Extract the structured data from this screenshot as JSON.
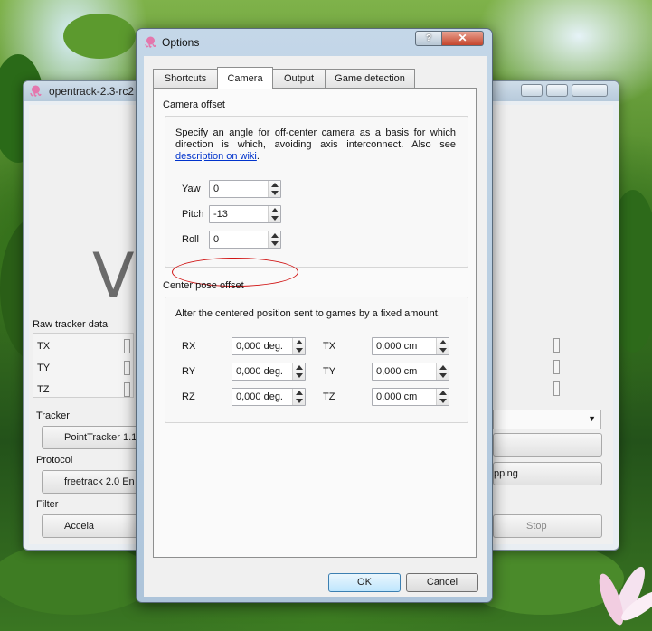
{
  "main_window": {
    "title": "opentrack-2.3-rc2",
    "big_text": "VI",
    "raw_tracker_label": "Raw tracker data",
    "axes": [
      "TX",
      "TY",
      "TZ"
    ],
    "tracker_label": "Tracker",
    "tracker_value": "PointTracker 1.1",
    "protocol_label": "Protocol",
    "protocol_value": "freetrack 2.0 En",
    "filter_label": "Filter",
    "filter_value": "Accela",
    "mapping_button": "pping",
    "stop_button": "Stop"
  },
  "dialog": {
    "title": "Options",
    "help_glyph": "?",
    "close_glyph": "✕",
    "tabs": [
      {
        "label": "Shortcuts"
      },
      {
        "label": "Camera"
      },
      {
        "label": "Output"
      },
      {
        "label": "Game detection"
      }
    ],
    "camera_offset": {
      "title": "Camera offset",
      "description": "Specify an angle for off-center camera as a basis for which direction is which, avoiding axis interconnect. Also see",
      "link_text": "description on wiki",
      "link_suffix": ".",
      "fields": [
        {
          "label": "Yaw",
          "value": "0"
        },
        {
          "label": "Pitch",
          "value": "-13"
        },
        {
          "label": "Roll",
          "value": "0"
        }
      ]
    },
    "center_pose": {
      "title": "Center pose offset",
      "description": "Alter the centered position sent to games by a fixed amount.",
      "rows": [
        {
          "rot_label": "RX",
          "rot_value": "0,000 deg.",
          "tr_label": "TX",
          "tr_value": "0,000 cm"
        },
        {
          "rot_label": "RY",
          "rot_value": "0,000 deg.",
          "tr_label": "TY",
          "tr_value": "0,000 cm"
        },
        {
          "rot_label": "RZ",
          "rot_value": "0,000 deg.",
          "tr_label": "TZ",
          "tr_value": "0,000 cm"
        }
      ]
    },
    "ok_label": "OK",
    "cancel_label": "Cancel"
  },
  "colors": {
    "highlight_circle": "#d01414",
    "link": "#0033cc",
    "close_button": "#c5452c"
  }
}
